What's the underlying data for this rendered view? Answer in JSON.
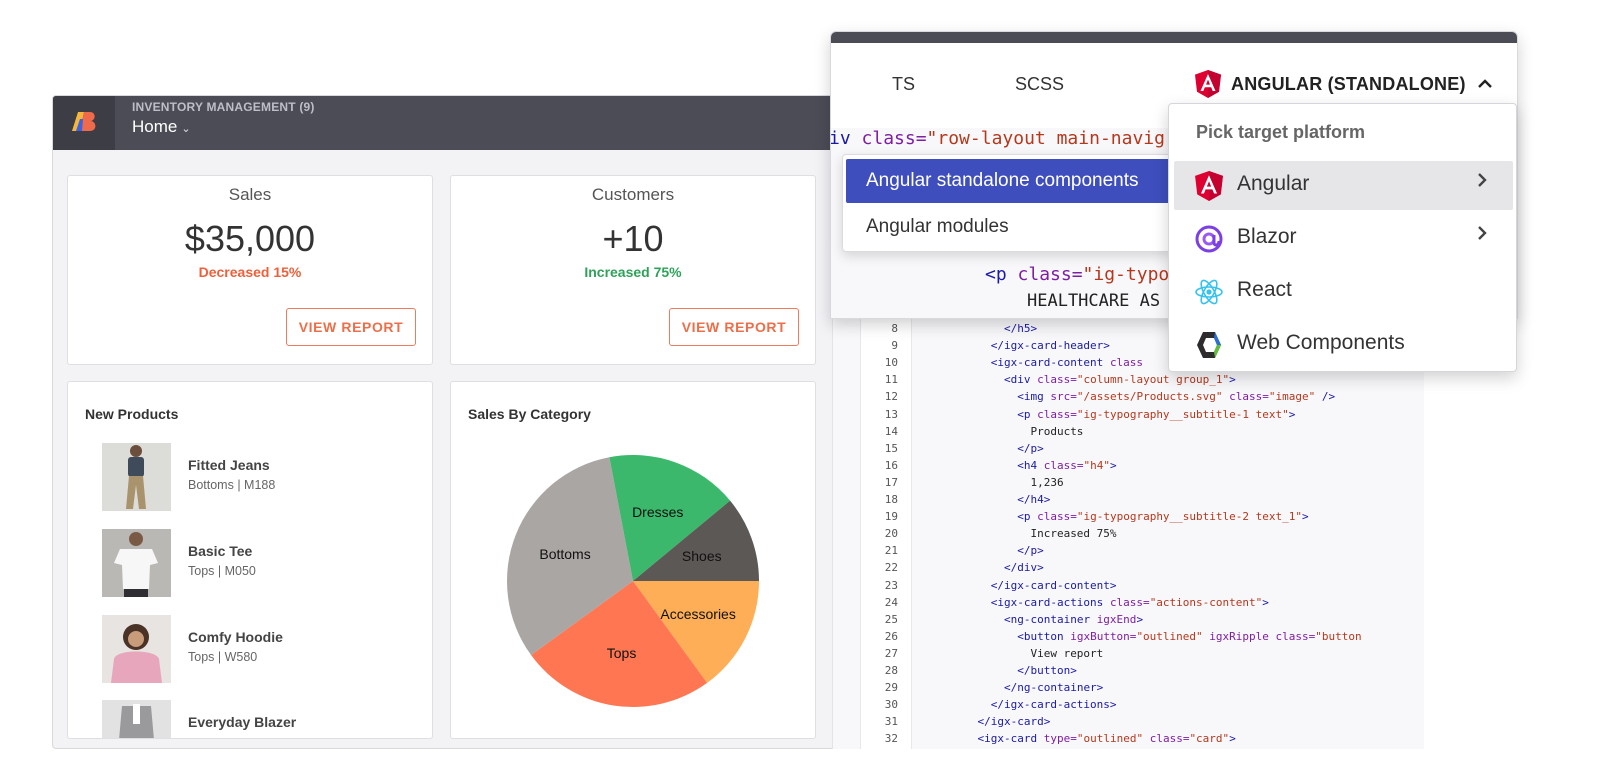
{
  "app": {
    "subtitle": "INVENTORY MANAGEMENT (9)",
    "nav_label": "Home",
    "nav_chevron": "⌄"
  },
  "stats": [
    {
      "title": "Sales",
      "value": "$35,000",
      "delta": "Decreased 15%",
      "delta_color": "#ee5f3a",
      "button": "VIEW REPORT"
    },
    {
      "title": "Customers",
      "value": "+10",
      "delta": "Increased 75%",
      "delta_color": "#2fa25a",
      "button": "VIEW REPORT"
    }
  ],
  "new_products": {
    "heading": "New Products",
    "items": [
      {
        "name": "Fitted Jeans",
        "meta": "Bottoms | M188"
      },
      {
        "name": "Basic Tee",
        "meta": "Tops | M050"
      },
      {
        "name": "Comfy Hoodie",
        "meta": "Tops | W580"
      },
      {
        "name": "Everyday Blazer",
        "meta": ""
      }
    ]
  },
  "sales_by_category": {
    "heading": "Sales By Category"
  },
  "chart_data": {
    "type": "pie",
    "title": "Sales By Category",
    "slices": [
      {
        "label": "Accessories",
        "value": 15,
        "color": "#fdae56"
      },
      {
        "label": "Tops",
        "value": 25,
        "color": "#ff7752"
      },
      {
        "label": "Bottoms",
        "value": 32,
        "color": "#aaa6a4"
      },
      {
        "label": "Dresses",
        "value": 17,
        "color": "#3bb86b"
      },
      {
        "label": "Shoes",
        "value": 11,
        "color": "#5c5856"
      }
    ]
  },
  "panel": {
    "tabs": [
      "TS",
      "SCSS"
    ],
    "platform_tab": "ANGULAR (STANDALONE)",
    "code_line_1": {
      "tag": "iv ",
      "attr": "class=",
      "value": "\"row-layout main-navig"
    },
    "code_line_2": {
      "tag": "<p ",
      "attr": "class=",
      "value": "\"ig-typog"
    },
    "code_line_3": "HEALTHCARE AS"
  },
  "variant_menu": {
    "items": [
      "Angular standalone components",
      "Angular modules"
    ],
    "active_index": 0
  },
  "platform_menu": {
    "title": "Pick target platform",
    "items": [
      {
        "label": "Angular",
        "icon": "angular-icon",
        "has_submenu": true
      },
      {
        "label": "Blazor",
        "icon": "blazor-icon",
        "has_submenu": true
      },
      {
        "label": "React",
        "icon": "react-icon",
        "has_submenu": false
      },
      {
        "label": "Web Components",
        "icon": "web-components-icon",
        "has_submenu": false
      }
    ],
    "arrow": "›"
  },
  "code": {
    "lines": [
      {
        "n": "8",
        "indent": "        ",
        "parts": [
          [
            "tag",
            "</h5>"
          ]
        ]
      },
      {
        "n": "9",
        "indent": "      ",
        "parts": [
          [
            "tag",
            "</igx-card-header>"
          ]
        ]
      },
      {
        "n": "10",
        "indent": "      ",
        "parts": [
          [
            "tag",
            "<igx-card-content "
          ],
          [
            "attr",
            "class"
          ]
        ]
      },
      {
        "n": "11",
        "indent": "        ",
        "parts": [
          [
            "tag",
            "<div "
          ],
          [
            "attr",
            "class="
          ],
          [
            "str",
            "\"column-layout group_1\""
          ],
          [
            "tag",
            ">"
          ]
        ]
      },
      {
        "n": "12",
        "indent": "          ",
        "parts": [
          [
            "tag",
            "<img "
          ],
          [
            "attr",
            "src="
          ],
          [
            "str",
            "\"/assets/Products.svg\""
          ],
          [
            "attr",
            " class="
          ],
          [
            "str",
            "\"image\""
          ],
          [
            "tag",
            " />"
          ]
        ]
      },
      {
        "n": "13",
        "indent": "          ",
        "parts": [
          [
            "tag",
            "<p "
          ],
          [
            "attr",
            "class="
          ],
          [
            "str",
            "\"ig-typography__subtitle-1 text\""
          ],
          [
            "tag",
            ">"
          ]
        ]
      },
      {
        "n": "14",
        "indent": "            ",
        "parts": [
          [
            "text",
            "Products"
          ]
        ]
      },
      {
        "n": "15",
        "indent": "          ",
        "parts": [
          [
            "tag",
            "</p>"
          ]
        ]
      },
      {
        "n": "16",
        "indent": "          ",
        "parts": [
          [
            "tag",
            "<h4 "
          ],
          [
            "attr",
            "class="
          ],
          [
            "str",
            "\"h4\""
          ],
          [
            "tag",
            ">"
          ]
        ]
      },
      {
        "n": "17",
        "indent": "            ",
        "parts": [
          [
            "text",
            "1,236"
          ]
        ]
      },
      {
        "n": "18",
        "indent": "          ",
        "parts": [
          [
            "tag",
            "</h4>"
          ]
        ]
      },
      {
        "n": "19",
        "indent": "          ",
        "parts": [
          [
            "tag",
            "<p "
          ],
          [
            "attr",
            "class="
          ],
          [
            "str",
            "\"ig-typography__subtitle-2 text_1\""
          ],
          [
            "tag",
            ">"
          ]
        ]
      },
      {
        "n": "20",
        "indent": "            ",
        "parts": [
          [
            "text",
            "Increased 75%"
          ]
        ]
      },
      {
        "n": "21",
        "indent": "          ",
        "parts": [
          [
            "tag",
            "</p>"
          ]
        ]
      },
      {
        "n": "22",
        "indent": "        ",
        "parts": [
          [
            "tag",
            "</div>"
          ]
        ]
      },
      {
        "n": "23",
        "indent": "      ",
        "parts": [
          [
            "tag",
            "</igx-card-content>"
          ]
        ]
      },
      {
        "n": "24",
        "indent": "      ",
        "parts": [
          [
            "tag",
            "<igx-card-actions "
          ],
          [
            "attr",
            "class="
          ],
          [
            "str",
            "\"actions-content\""
          ],
          [
            "tag",
            ">"
          ]
        ]
      },
      {
        "n": "25",
        "indent": "        ",
        "parts": [
          [
            "tag",
            "<ng-container "
          ],
          [
            "attr",
            "igxEnd"
          ],
          [
            "tag",
            ">"
          ]
        ]
      },
      {
        "n": "26",
        "indent": "          ",
        "parts": [
          [
            "tag",
            "<button "
          ],
          [
            "attr",
            "igxButton="
          ],
          [
            "str",
            "\"outlined\""
          ],
          [
            "attr",
            " igxRipple class="
          ],
          [
            "str",
            "\"button"
          ]
        ]
      },
      {
        "n": "27",
        "indent": "            ",
        "parts": [
          [
            "text",
            "View report"
          ]
        ]
      },
      {
        "n": "28",
        "indent": "          ",
        "parts": [
          [
            "tag",
            "</button>"
          ]
        ]
      },
      {
        "n": "29",
        "indent": "        ",
        "parts": [
          [
            "tag",
            "</ng-container>"
          ]
        ]
      },
      {
        "n": "30",
        "indent": "      ",
        "parts": [
          [
            "tag",
            "</igx-card-actions>"
          ]
        ]
      },
      {
        "n": "31",
        "indent": "    ",
        "parts": [
          [
            "tag",
            "</igx-card>"
          ]
        ]
      },
      {
        "n": "32",
        "indent": "    ",
        "parts": [
          [
            "tag",
            "<igx-card "
          ],
          [
            "attr",
            "type="
          ],
          [
            "str",
            "\"outlined\""
          ],
          [
            "attr",
            " class="
          ],
          [
            "str",
            "\"card\""
          ],
          [
            "tag",
            ">"
          ]
        ]
      }
    ]
  }
}
